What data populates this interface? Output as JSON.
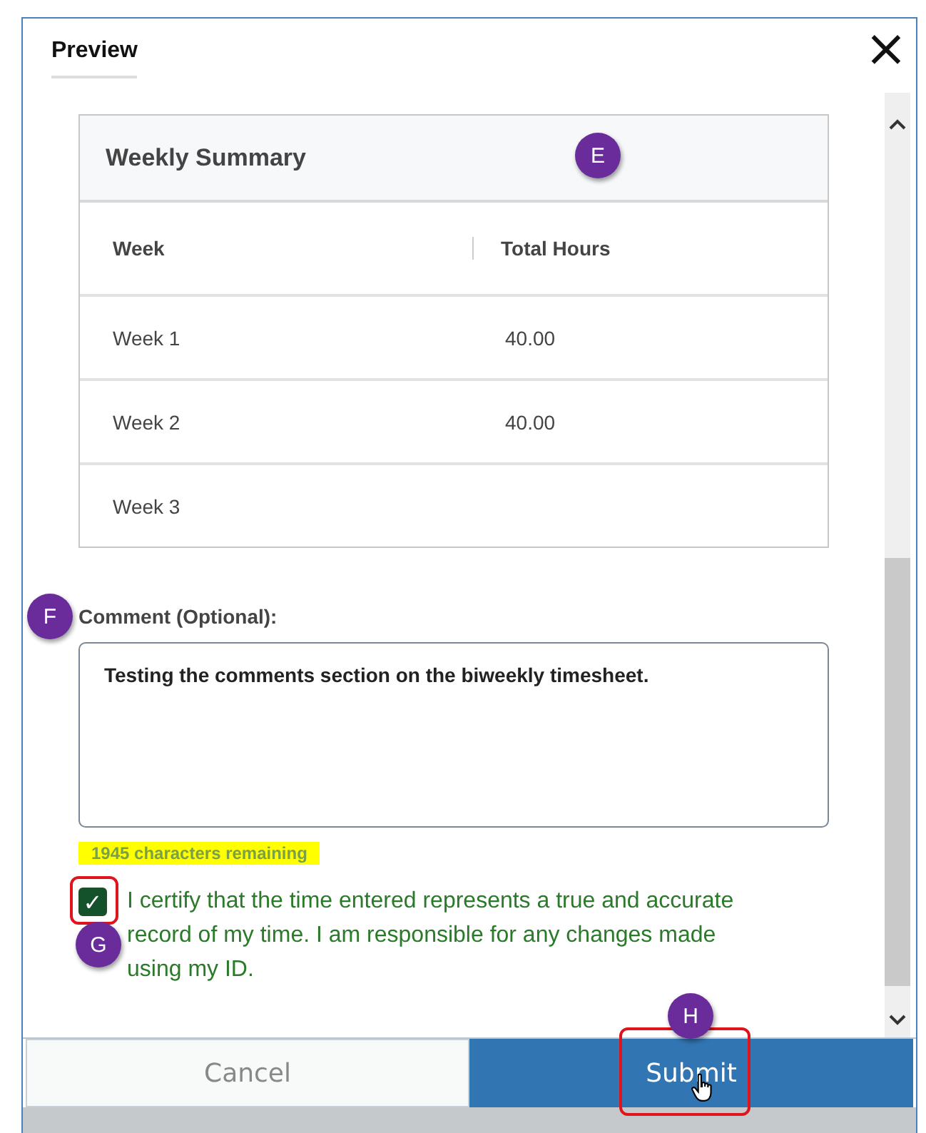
{
  "dialog": {
    "title": "Preview",
    "close_glyph": "×"
  },
  "summary": {
    "title": "Weekly Summary",
    "columns": [
      "Week",
      "Total Hours"
    ],
    "rows": [
      [
        "Week 1",
        "40.00"
      ],
      [
        "Week 2",
        "40.00"
      ],
      [
        "Week 3",
        ""
      ]
    ]
  },
  "comment": {
    "label": "Comment (Optional):",
    "value": "Testing the comments section on the biweekly timesheet.",
    "remaining": "1945 characters remaining",
    "remaining_highlighted": true
  },
  "certify": {
    "checked": true,
    "check_glyph": "✓",
    "text": "I certify that the time entered represents a true and accurate record of my time. I am responsible for any changes made using my ID.",
    "highlighted": true
  },
  "buttons": [
    {
      "label": "Cancel",
      "kind": "secondary",
      "highlighted": false
    },
    {
      "label": "Submit",
      "kind": "primary",
      "highlighted": true
    }
  ],
  "callouts": [
    {
      "label": "E"
    },
    {
      "label": "F"
    },
    {
      "label": "G"
    },
    {
      "label": "H"
    }
  ]
}
